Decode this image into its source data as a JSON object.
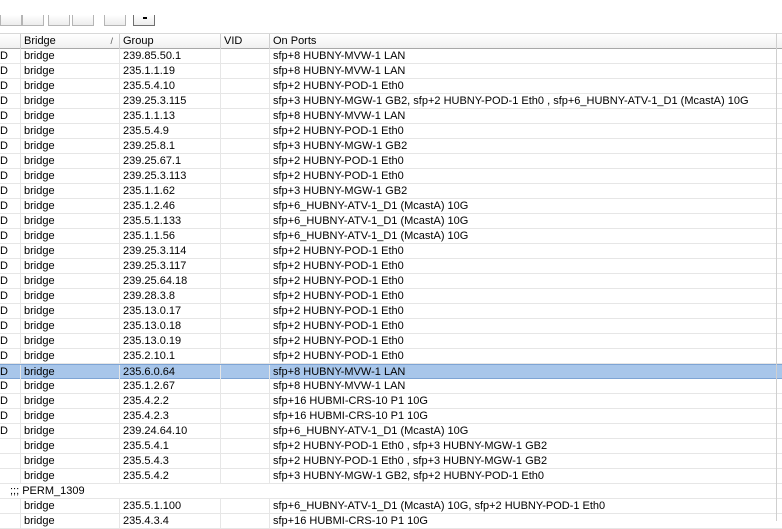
{
  "columns": [
    "Bridge",
    "Group",
    "VID",
    "On Ports"
  ],
  "rows": [
    {
      "f": "D",
      "bridge": "bridge",
      "group": "239.85.50.1",
      "vid": "",
      "ports": "sfp+8 HUBNY-MVW-1 LAN"
    },
    {
      "f": "D",
      "bridge": "bridge",
      "group": "235.1.1.19",
      "vid": "",
      "ports": "sfp+8 HUBNY-MVW-1 LAN"
    },
    {
      "f": "D",
      "bridge": "bridge",
      "group": "235.5.4.10",
      "vid": "",
      "ports": "sfp+2 HUBNY-POD-1 Eth0"
    },
    {
      "f": "D",
      "bridge": "bridge",
      "group": "239.25.3.115",
      "vid": "",
      "ports": "sfp+3 HUBNY-MGW-1 GB2, sfp+2 HUBNY-POD-1 Eth0 , sfp+6_HUBNY-ATV-1_D1 (McastA) 10G"
    },
    {
      "f": "D",
      "bridge": "bridge",
      "group": "235.1.1.13",
      "vid": "",
      "ports": "sfp+8 HUBNY-MVW-1 LAN"
    },
    {
      "f": "D",
      "bridge": "bridge",
      "group": "235.5.4.9",
      "vid": "",
      "ports": "sfp+2 HUBNY-POD-1 Eth0"
    },
    {
      "f": "D",
      "bridge": "bridge",
      "group": "239.25.8.1",
      "vid": "",
      "ports": "sfp+3 HUBNY-MGW-1 GB2"
    },
    {
      "f": "D",
      "bridge": "bridge",
      "group": "239.25.67.1",
      "vid": "",
      "ports": "sfp+2 HUBNY-POD-1 Eth0"
    },
    {
      "f": "D",
      "bridge": "bridge",
      "group": "239.25.3.113",
      "vid": "",
      "ports": "sfp+2 HUBNY-POD-1 Eth0"
    },
    {
      "f": "D",
      "bridge": "bridge",
      "group": "235.1.1.62",
      "vid": "",
      "ports": "sfp+3 HUBNY-MGW-1 GB2"
    },
    {
      "f": "D",
      "bridge": "bridge",
      "group": "235.1.2.46",
      "vid": "",
      "ports": "sfp+6_HUBNY-ATV-1_D1 (McastA) 10G"
    },
    {
      "f": "D",
      "bridge": "bridge",
      "group": "235.5.1.133",
      "vid": "",
      "ports": "sfp+6_HUBNY-ATV-1_D1 (McastA) 10G"
    },
    {
      "f": "D",
      "bridge": "bridge",
      "group": "235.1.1.56",
      "vid": "",
      "ports": "sfp+6_HUBNY-ATV-1_D1 (McastA) 10G"
    },
    {
      "f": "D",
      "bridge": "bridge",
      "group": "239.25.3.114",
      "vid": "",
      "ports": "sfp+2 HUBNY-POD-1 Eth0"
    },
    {
      "f": "D",
      "bridge": "bridge",
      "group": "239.25.3.117",
      "vid": "",
      "ports": "sfp+2 HUBNY-POD-1 Eth0"
    },
    {
      "f": "D",
      "bridge": "bridge",
      "group": "239.25.64.18",
      "vid": "",
      "ports": "sfp+2 HUBNY-POD-1 Eth0"
    },
    {
      "f": "D",
      "bridge": "bridge",
      "group": "239.28.3.8",
      "vid": "",
      "ports": "sfp+2 HUBNY-POD-1 Eth0"
    },
    {
      "f": "D",
      "bridge": "bridge",
      "group": "235.13.0.17",
      "vid": "",
      "ports": "sfp+2 HUBNY-POD-1 Eth0"
    },
    {
      "f": "D",
      "bridge": "bridge",
      "group": "235.13.0.18",
      "vid": "",
      "ports": "sfp+2 HUBNY-POD-1 Eth0"
    },
    {
      "f": "D",
      "bridge": "bridge",
      "group": "235.13.0.19",
      "vid": "",
      "ports": "sfp+2 HUBNY-POD-1 Eth0"
    },
    {
      "f": "D",
      "bridge": "bridge",
      "group": "235.2.10.1",
      "vid": "",
      "ports": "sfp+2 HUBNY-POD-1 Eth0"
    },
    {
      "f": "D",
      "bridge": "bridge",
      "group": "235.6.0.64",
      "vid": "",
      "ports": "sfp+8 HUBNY-MVW-1 LAN",
      "selected": true
    },
    {
      "f": "D",
      "bridge": "bridge",
      "group": "235.1.2.67",
      "vid": "",
      "ports": "sfp+8 HUBNY-MVW-1 LAN"
    },
    {
      "f": "D",
      "bridge": "bridge",
      "group": "235.4.2.2",
      "vid": "",
      "ports": "sfp+16 HUBMI-CRS-10 P1 10G"
    },
    {
      "f": "D",
      "bridge": "bridge",
      "group": "235.4.2.3",
      "vid": "",
      "ports": "sfp+16 HUBMI-CRS-10 P1 10G"
    },
    {
      "f": "D",
      "bridge": "bridge",
      "group": "239.24.64.10",
      "vid": "",
      "ports": "sfp+6_HUBNY-ATV-1_D1 (McastA) 10G"
    },
    {
      "f": "",
      "bridge": "bridge",
      "group": "235.5.4.1",
      "vid": "",
      "ports": "sfp+2 HUBNY-POD-1 Eth0 , sfp+3 HUBNY-MGW-1 GB2"
    },
    {
      "f": "",
      "bridge": "bridge",
      "group": "235.5.4.3",
      "vid": "",
      "ports": "sfp+2 HUBNY-POD-1 Eth0 , sfp+3 HUBNY-MGW-1 GB2"
    },
    {
      "f": "",
      "bridge": "bridge",
      "group": "235.5.4.2",
      "vid": "",
      "ports": "sfp+3 HUBNY-MGW-1 GB2, sfp+2 HUBNY-POD-1 Eth0"
    },
    {
      "comment": ";;; PERM_1309"
    },
    {
      "f": "",
      "bridge": "bridge",
      "group": "235.5.1.100",
      "vid": "",
      "ports": "sfp+6_HUBNY-ATV-1_D1 (McastA) 10G, sfp+2 HUBNY-POD-1 Eth0"
    },
    {
      "f": "",
      "bridge": "bridge",
      "group": "235.4.3.4",
      "vid": "",
      "ports": "sfp+16 HUBMI-CRS-10 P1 10G"
    }
  ],
  "colors": {
    "selected_row": "#a8c6ea",
    "grid_line": "#e6e6e6"
  }
}
